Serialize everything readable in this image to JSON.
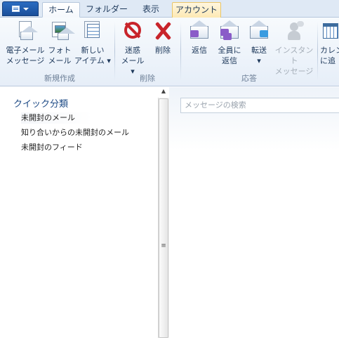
{
  "tabs": {
    "home": "ホーム",
    "folder": "フォルダー",
    "view": "表示",
    "account": "アカウント"
  },
  "ribbon": {
    "new_group": {
      "label": "新規作成",
      "email_line1": "電子メール",
      "email_line2": "メッセージ",
      "photo_line1": "フォト",
      "photo_line2": "メール",
      "items_line1": "新しい",
      "items_line2": "アイテム ▾"
    },
    "delete_group": {
      "label": "削除",
      "junk_line1": "迷惑",
      "junk_line2": "メール ▾",
      "delete": "削除"
    },
    "respond_group": {
      "label": "応答",
      "reply": "返信",
      "reply_all_line1": "全員に",
      "reply_all_line2": "返信",
      "forward": "転送",
      "forward_caret": "▾",
      "im_line1": "インスタント",
      "im_line2": "メッセージ"
    },
    "calendar_line1": "カレン",
    "calendar_line2": "に追"
  },
  "nav": {
    "title": "クイック分類",
    "items": [
      {
        "label": "未開封のメール"
      },
      {
        "label": "知り合いからの未開封のメール"
      },
      {
        "label": "未開封のフィード"
      }
    ]
  },
  "search": {
    "placeholder": "メッセージの検索"
  },
  "scrollbar": {
    "up_glyph": "▲",
    "grip_glyph": "≡"
  },
  "colors": {
    "accent": "#2b6dc2",
    "nav_title": "#1e4b86",
    "junk_red": "#c8242b",
    "account_tab": "#fde9b4"
  }
}
